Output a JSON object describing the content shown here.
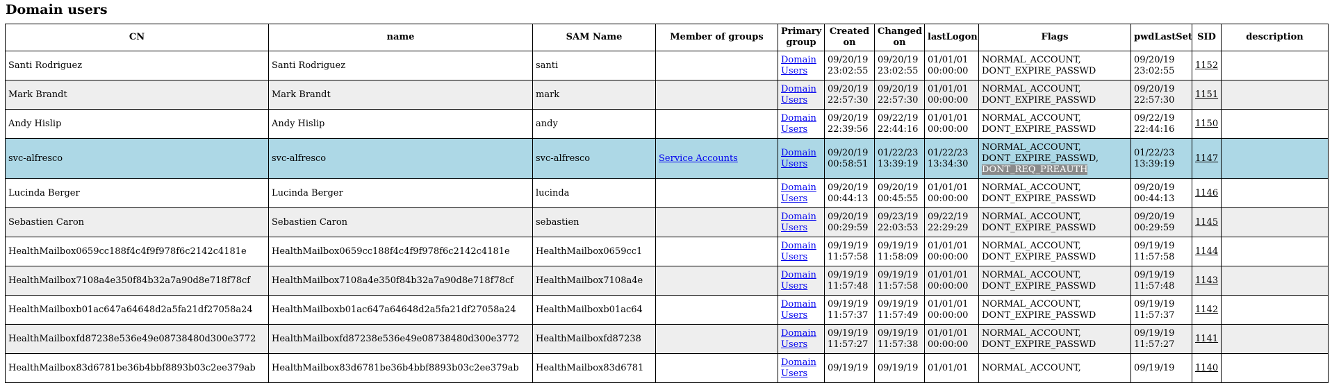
{
  "title": "Domain users",
  "columns": {
    "cn": "CN",
    "name": "name",
    "sam": "SAM Name",
    "member": "Member of groups",
    "primary_1": "Primary",
    "primary_2": "group",
    "created_1": "Created",
    "created_2": "on",
    "changed_1": "Changed",
    "changed_2": "on",
    "lastlogon": "lastLogon",
    "flags": "Flags",
    "pwdlastset": "pwdLastSet",
    "sid": "SID",
    "description": "description"
  },
  "rows": [
    {
      "cn": "Santi Rodriguez",
      "name": "Santi Rodriguez",
      "sam": "santi",
      "member": "",
      "primary_1": "Domain",
      "primary_2": "Users",
      "created_1": "09/20/19",
      "created_2": "23:02:55",
      "changed_1": "09/20/19",
      "changed_2": "23:02:55",
      "lastlogon_1": "01/01/01",
      "lastlogon_2": "00:00:00",
      "flags_1": "NORMAL_ACCOUNT,",
      "flags_2": "DONT_EXPIRE_PASSWD",
      "pwd_1": "09/20/19",
      "pwd_2": "23:02:55",
      "sid": "1152",
      "description": ""
    },
    {
      "cn": "Mark Brandt",
      "name": "Mark Brandt",
      "sam": "mark",
      "member": "",
      "primary_1": "Domain",
      "primary_2": "Users",
      "created_1": "09/20/19",
      "created_2": "22:57:30",
      "changed_1": "09/20/19",
      "changed_2": "22:57:30",
      "lastlogon_1": "01/01/01",
      "lastlogon_2": "00:00:00",
      "flags_1": "NORMAL_ACCOUNT,",
      "flags_2": "DONT_EXPIRE_PASSWD",
      "pwd_1": "09/20/19",
      "pwd_2": "22:57:30",
      "sid": "1151",
      "description": ""
    },
    {
      "cn": "Andy Hislip",
      "name": "Andy Hislip",
      "sam": "andy",
      "member": "",
      "primary_1": "Domain",
      "primary_2": "Users",
      "created_1": "09/20/19",
      "created_2": "22:39:56",
      "changed_1": "09/22/19",
      "changed_2": "22:44:16",
      "lastlogon_1": "01/01/01",
      "lastlogon_2": "00:00:00",
      "flags_1": "NORMAL_ACCOUNT,",
      "flags_2": "DONT_EXPIRE_PASSWD",
      "pwd_1": "09/22/19",
      "pwd_2": "22:44:16",
      "sid": "1150",
      "description": ""
    },
    {
      "cn": "svc-alfresco",
      "name": "svc-alfresco",
      "sam": "svc-alfresco",
      "member": "Service Accounts",
      "primary_1": "Domain",
      "primary_2": "Users",
      "created_1": "09/20/19",
      "created_2": "00:58:51",
      "changed_1": "01/22/23",
      "changed_2": "13:39:19",
      "lastlogon_1": "01/22/23",
      "lastlogon_2": "13:34:30",
      "flags_1": "NORMAL_ACCOUNT,",
      "flags_2": "DONT_EXPIRE_PASSWD,",
      "flags_3": "DONT_REQ_PREAUTH",
      "pwd_1": "01/22/23",
      "pwd_2": "13:39:19",
      "sid": "1147",
      "description": ""
    },
    {
      "cn": "Lucinda Berger",
      "name": "Lucinda Berger",
      "sam": "lucinda",
      "member": "",
      "primary_1": "Domain",
      "primary_2": "Users",
      "created_1": "09/20/19",
      "created_2": "00:44:13",
      "changed_1": "09/20/19",
      "changed_2": "00:45:55",
      "lastlogon_1": "01/01/01",
      "lastlogon_2": "00:00:00",
      "flags_1": "NORMAL_ACCOUNT,",
      "flags_2": "DONT_EXPIRE_PASSWD",
      "pwd_1": "09/20/19",
      "pwd_2": "00:44:13",
      "sid": "1146",
      "description": ""
    },
    {
      "cn": "Sebastien Caron",
      "name": "Sebastien Caron",
      "sam": "sebastien",
      "member": "",
      "primary_1": "Domain",
      "primary_2": "Users",
      "created_1": "09/20/19",
      "created_2": "00:29:59",
      "changed_1": "09/23/19",
      "changed_2": "22:03:53",
      "lastlogon_1": "09/22/19",
      "lastlogon_2": "22:29:29",
      "flags_1": "NORMAL_ACCOUNT,",
      "flags_2": "DONT_EXPIRE_PASSWD",
      "pwd_1": "09/20/19",
      "pwd_2": "00:29:59",
      "sid": "1145",
      "description": ""
    },
    {
      "cn": "HealthMailbox0659cc188f4c4f9f978f6c2142c4181e",
      "name": "HealthMailbox0659cc188f4c4f9f978f6c2142c4181e",
      "sam": "HealthMailbox0659cc1",
      "member": "",
      "primary_1": "Domain",
      "primary_2": "Users",
      "created_1": "09/19/19",
      "created_2": "11:57:58",
      "changed_1": "09/19/19",
      "changed_2": "11:58:09",
      "lastlogon_1": "01/01/01",
      "lastlogon_2": "00:00:00",
      "flags_1": "NORMAL_ACCOUNT,",
      "flags_2": "DONT_EXPIRE_PASSWD",
      "pwd_1": "09/19/19",
      "pwd_2": "11:57:58",
      "sid": "1144",
      "description": ""
    },
    {
      "cn": "HealthMailbox7108a4e350f84b32a7a90d8e718f78cf",
      "name": "HealthMailbox7108a4e350f84b32a7a90d8e718f78cf",
      "sam": "HealthMailbox7108a4e",
      "member": "",
      "primary_1": "Domain",
      "primary_2": "Users",
      "created_1": "09/19/19",
      "created_2": "11:57:48",
      "changed_1": "09/19/19",
      "changed_2": "11:57:58",
      "lastlogon_1": "01/01/01",
      "lastlogon_2": "00:00:00",
      "flags_1": "NORMAL_ACCOUNT,",
      "flags_2": "DONT_EXPIRE_PASSWD",
      "pwd_1": "09/19/19",
      "pwd_2": "11:57:48",
      "sid": "1143",
      "description": ""
    },
    {
      "cn": "HealthMailboxb01ac647a64648d2a5fa21df27058a24",
      "name": "HealthMailboxb01ac647a64648d2a5fa21df27058a24",
      "sam": "HealthMailboxb01ac64",
      "member": "",
      "primary_1": "Domain",
      "primary_2": "Users",
      "created_1": "09/19/19",
      "created_2": "11:57:37",
      "changed_1": "09/19/19",
      "changed_2": "11:57:49",
      "lastlogon_1": "01/01/01",
      "lastlogon_2": "00:00:00",
      "flags_1": "NORMAL_ACCOUNT,",
      "flags_2": "DONT_EXPIRE_PASSWD",
      "pwd_1": "09/19/19",
      "pwd_2": "11:57:37",
      "sid": "1142",
      "description": ""
    },
    {
      "cn": "HealthMailboxfd87238e536e49e08738480d300e3772",
      "name": "HealthMailboxfd87238e536e49e08738480d300e3772",
      "sam": "HealthMailboxfd87238",
      "member": "",
      "primary_1": "Domain",
      "primary_2": "Users",
      "created_1": "09/19/19",
      "created_2": "11:57:27",
      "changed_1": "09/19/19",
      "changed_2": "11:57:38",
      "lastlogon_1": "01/01/01",
      "lastlogon_2": "00:00:00",
      "flags_1": "NORMAL_ACCOUNT,",
      "flags_2": "DONT_EXPIRE_PASSWD",
      "pwd_1": "09/19/19",
      "pwd_2": "11:57:27",
      "sid": "1141",
      "description": ""
    },
    {
      "cn": "HealthMailbox83d6781be36b4bbf8893b03c2ee379ab",
      "name": "HealthMailbox83d6781be36b4bbf8893b03c2ee379ab",
      "sam": "HealthMailbox83d6781",
      "member": "",
      "primary_1": "Domain",
      "primary_2": "Users",
      "created_1": "09/19/19",
      "created_2": "",
      "changed_1": "09/19/19",
      "changed_2": "",
      "lastlogon_1": "01/01/01",
      "lastlogon_2": "",
      "flags_1": "NORMAL_ACCOUNT,",
      "flags_2": "",
      "pwd_1": "09/19/19",
      "pwd_2": "",
      "sid": "1140",
      "description": ""
    }
  ]
}
